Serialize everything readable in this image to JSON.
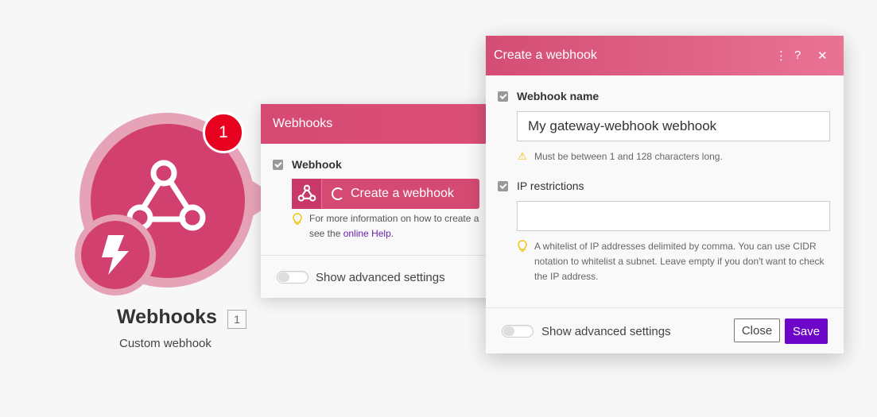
{
  "module": {
    "badge": "1",
    "title": "Webhooks",
    "id": "1",
    "subtitle": "Custom webhook",
    "icon": "webhook-icon",
    "trigger_icon": "lightning-icon",
    "color": "#d2406f"
  },
  "panel": {
    "title": "Webhooks",
    "field_label": "Webhook",
    "create_button": "Create a webhook",
    "hint_prefix": "For more information on how to create a",
    "hint_see": "see the ",
    "hint_link": "online Help",
    "hint_suffix": ".",
    "advanced": "Show advanced settings"
  },
  "dialog": {
    "title": "Create a webhook",
    "more_icon": "⋮",
    "help_icon": "?",
    "close_icon": "✕",
    "name_label": "Webhook name",
    "name_value": "My gateway-webhook webhook",
    "name_warning": "Must be between 1 and 128 characters long.",
    "ip_label": "IP restrictions",
    "ip_value": "",
    "ip_hint": "A whitelist of IP addresses delimited by comma. You can use CIDR notation to whitelist a subnet. Leave empty if you don't want to check the IP address.",
    "advanced": "Show advanced settings",
    "close_button": "Close",
    "save_button": "Save",
    "save_color": "#6d06c9"
  }
}
